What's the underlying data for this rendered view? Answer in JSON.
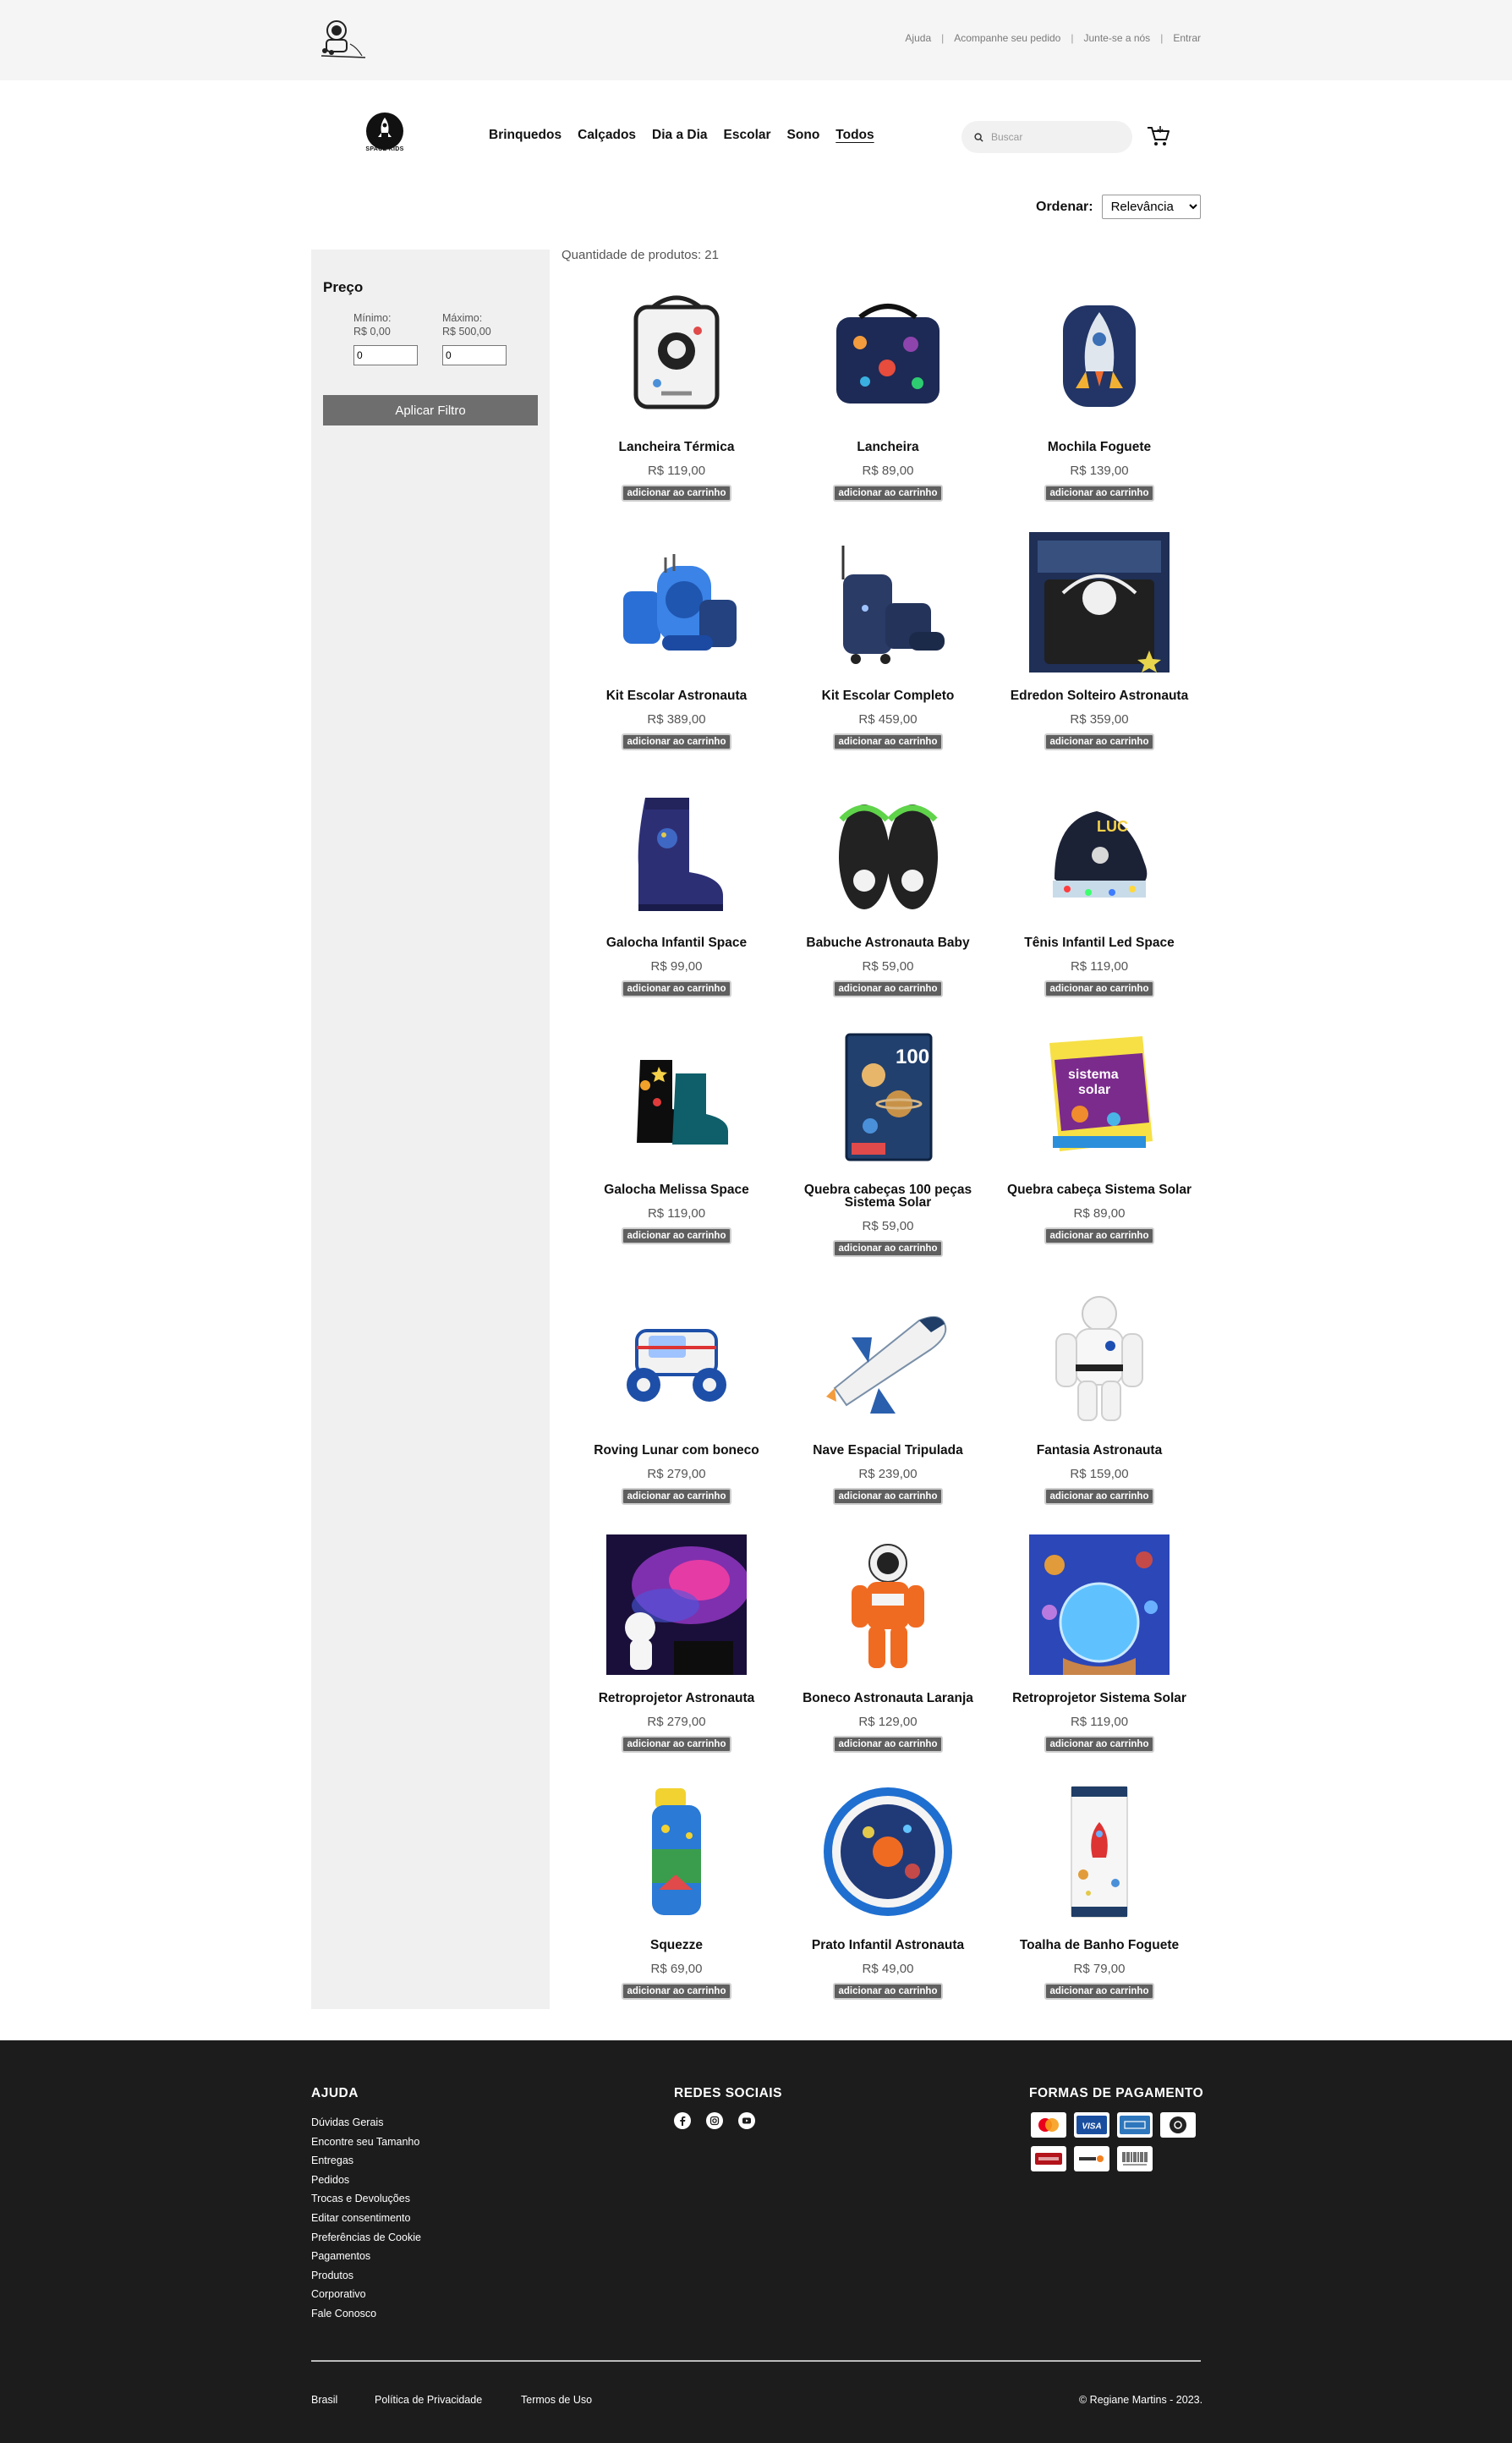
{
  "topbar": {
    "links": [
      "Ajuda",
      "Acompanhe seu pedido",
      "Junte-se a nós",
      "Entrar"
    ]
  },
  "header": {
    "brand_name": "SPACE KIDS",
    "nav": [
      "Brinquedos",
      "Calçados",
      "Dia a Dia",
      "Escolar",
      "Sono",
      "Todos"
    ],
    "active_nav": "Todos",
    "search_placeholder": "Buscar",
    "cart_icon": "cart-icon"
  },
  "sort": {
    "label": "Ordenar:",
    "selected": "Relevância"
  },
  "filters": {
    "title": "Preço",
    "min_label": "Mínimo:",
    "min_value": "R$ 0,00",
    "min_input": "0",
    "max_label": "Máximo:",
    "max_value": "R$ 500,00",
    "max_input": "0",
    "apply_label": "Aplicar Filtro"
  },
  "catalog": {
    "count_text": "Quantidade de produtos: 21",
    "add_label": "adicionar ao carrinho",
    "products": [
      {
        "name": "Lancheira Térmica",
        "price": "R$ 119,00",
        "art": "lunchbox-white",
        "row": 0,
        "col": 0
      },
      {
        "name": "Lancheira",
        "price": "R$ 89,00",
        "art": "lunchbox-navy",
        "row": 0,
        "col": 1
      },
      {
        "name": "Mochila Foguete",
        "price": "R$ 139,00",
        "art": "backpack-rocket",
        "row": 0,
        "col": 2
      },
      {
        "name": "Kit Escolar Astronauta",
        "price": "R$ 389,00",
        "art": "school-kit-blue",
        "row": 1,
        "col": 0
      },
      {
        "name": "Kit Escolar Completo",
        "price": "R$ 459,00",
        "art": "school-kit-navy",
        "row": 1,
        "col": 1
      },
      {
        "name": "Edredon Solteiro Astronauta",
        "price": "R$ 359,00",
        "art": "bed-photo",
        "row": 1,
        "col": 2
      },
      {
        "name": "Galocha Infantil Space",
        "price": "R$ 99,00",
        "art": "rain-boot",
        "row": 2,
        "col": 0
      },
      {
        "name": "Babuche Astronauta Baby",
        "price": "R$ 59,00",
        "art": "clogs",
        "row": 2,
        "col": 1
      },
      {
        "name": "Tênis Infantil Led Space",
        "price": "R$ 119,00",
        "art": "sneaker-led",
        "row": 2,
        "col": 2
      },
      {
        "name": "Galocha Melissa Space",
        "price": "R$ 119,00",
        "art": "boots-melissa",
        "row": 3,
        "col": 0
      },
      {
        "name": "Quebra cabeças 100 peças Sistema Solar",
        "price": "R$ 59,00",
        "art": "puzzle-box-100",
        "row": 3,
        "col": 1
      },
      {
        "name": "Quebra cabeça Sistema Solar",
        "price": "R$ 89,00",
        "art": "puzzle-box-solar",
        "row": 3,
        "col": 2
      },
      {
        "name": "Roving Lunar com boneco",
        "price": "R$ 279,00",
        "art": "lunar-rover",
        "row": 4,
        "col": 0
      },
      {
        "name": "Nave Espacial Tripulada",
        "price": "R$ 239,00",
        "art": "space-shuttle",
        "row": 4,
        "col": 1
      },
      {
        "name": "Fantasia Astronauta",
        "price": "R$ 159,00",
        "art": "astronaut-suit",
        "row": 4,
        "col": 2
      },
      {
        "name": "Retroprojetor Astronauta",
        "price": "R$ 279,00",
        "art": "projector-galaxy",
        "row": 5,
        "col": 0
      },
      {
        "name": "Boneco Astronauta Laranja",
        "price": "R$ 129,00",
        "art": "orange-astronaut",
        "row": 5,
        "col": 1
      },
      {
        "name": "Retroprojetor Sistema Solar",
        "price": "R$ 119,00",
        "art": "projector-planets",
        "row": 5,
        "col": 2
      },
      {
        "name": "Squezze",
        "price": "R$ 69,00",
        "art": "water-bottle",
        "row": 6,
        "col": 0
      },
      {
        "name": "Prato Infantil Astronauta",
        "price": "R$ 49,00",
        "art": "plate",
        "row": 6,
        "col": 1
      },
      {
        "name": "Toalha de Banho Foguete",
        "price": "R$ 79,00",
        "art": "towel",
        "row": 6,
        "col": 2
      }
    ]
  },
  "footer": {
    "help_title": "AJUDA",
    "help_links": [
      "Dúvidas Gerais",
      "Encontre seu Tamanho",
      "Entregas",
      "Pedidos",
      "Trocas e Devoluções",
      "Editar consentimento",
      "Preferências de Cookie",
      "Pagamentos",
      "Produtos",
      "Corporativo",
      "Fale Conosco"
    ],
    "social_title": "REDES SOCIAIS",
    "social_icons": [
      "facebook-icon",
      "instagram-icon",
      "youtube-icon"
    ],
    "payment_title": "FORMAS DE PAGAMENTO",
    "payment_icons": [
      "mastercard-icon",
      "visa-icon",
      "amex-icon",
      "elo-icon",
      "hipercard-icon",
      "discover-icon",
      "boleto-icon"
    ],
    "country": "Brasil",
    "privacy": "Política de Privacidade",
    "terms": "Termos de Uso",
    "copyright": "© Regiane Martins - 2023."
  }
}
